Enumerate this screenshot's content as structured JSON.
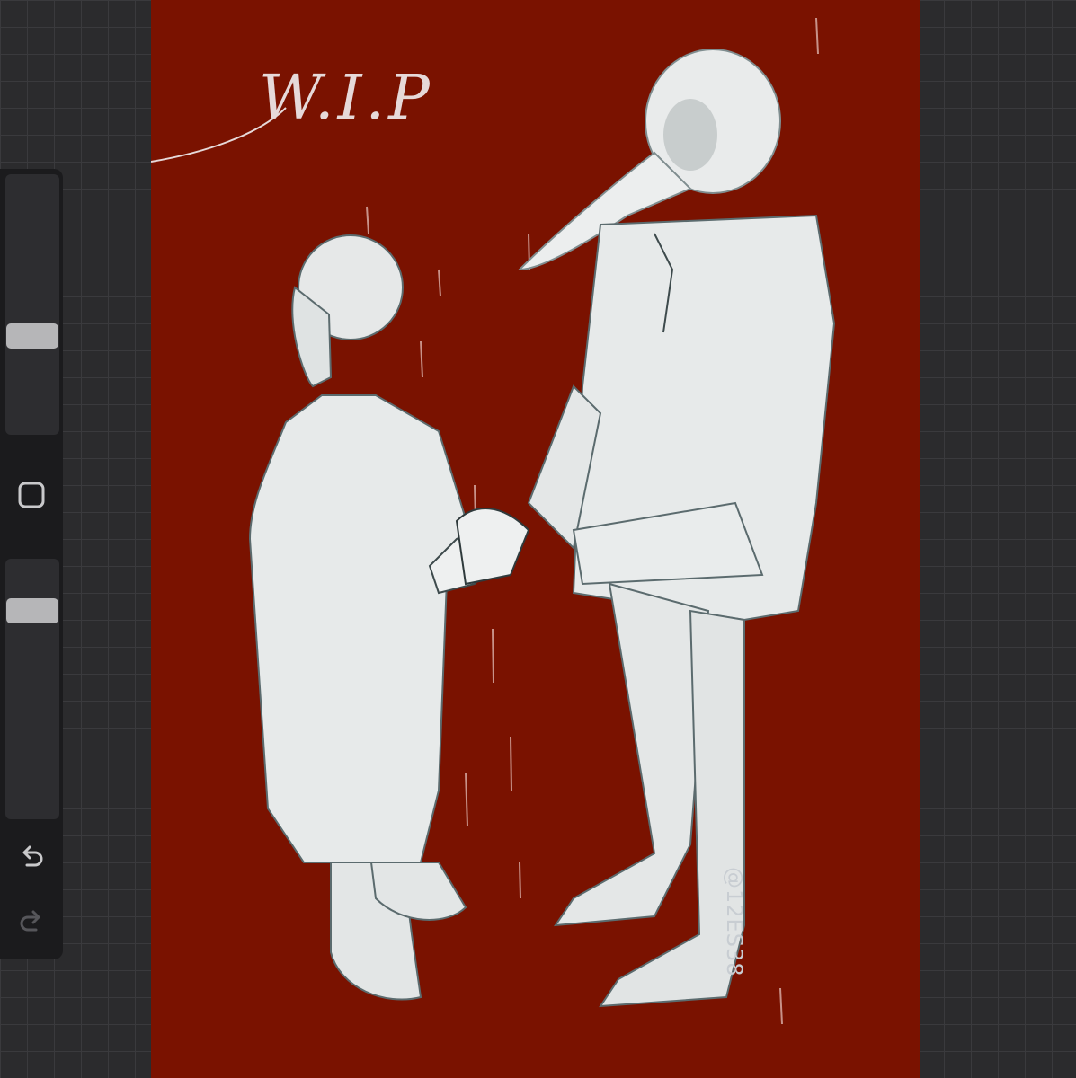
{
  "toolbar": {
    "brush_size_slider": {
      "value": 0.35
    },
    "opacity_slider": {
      "value": 0.8
    },
    "modify_button": {
      "icon": "square-icon"
    },
    "undo_button": {
      "icon": "undo-icon"
    },
    "redo_button": {
      "icon": "redo-icon"
    }
  },
  "canvas": {
    "background_color": "#7a1200",
    "overlay_text": "W.I.P",
    "signature": "@12ES38"
  }
}
